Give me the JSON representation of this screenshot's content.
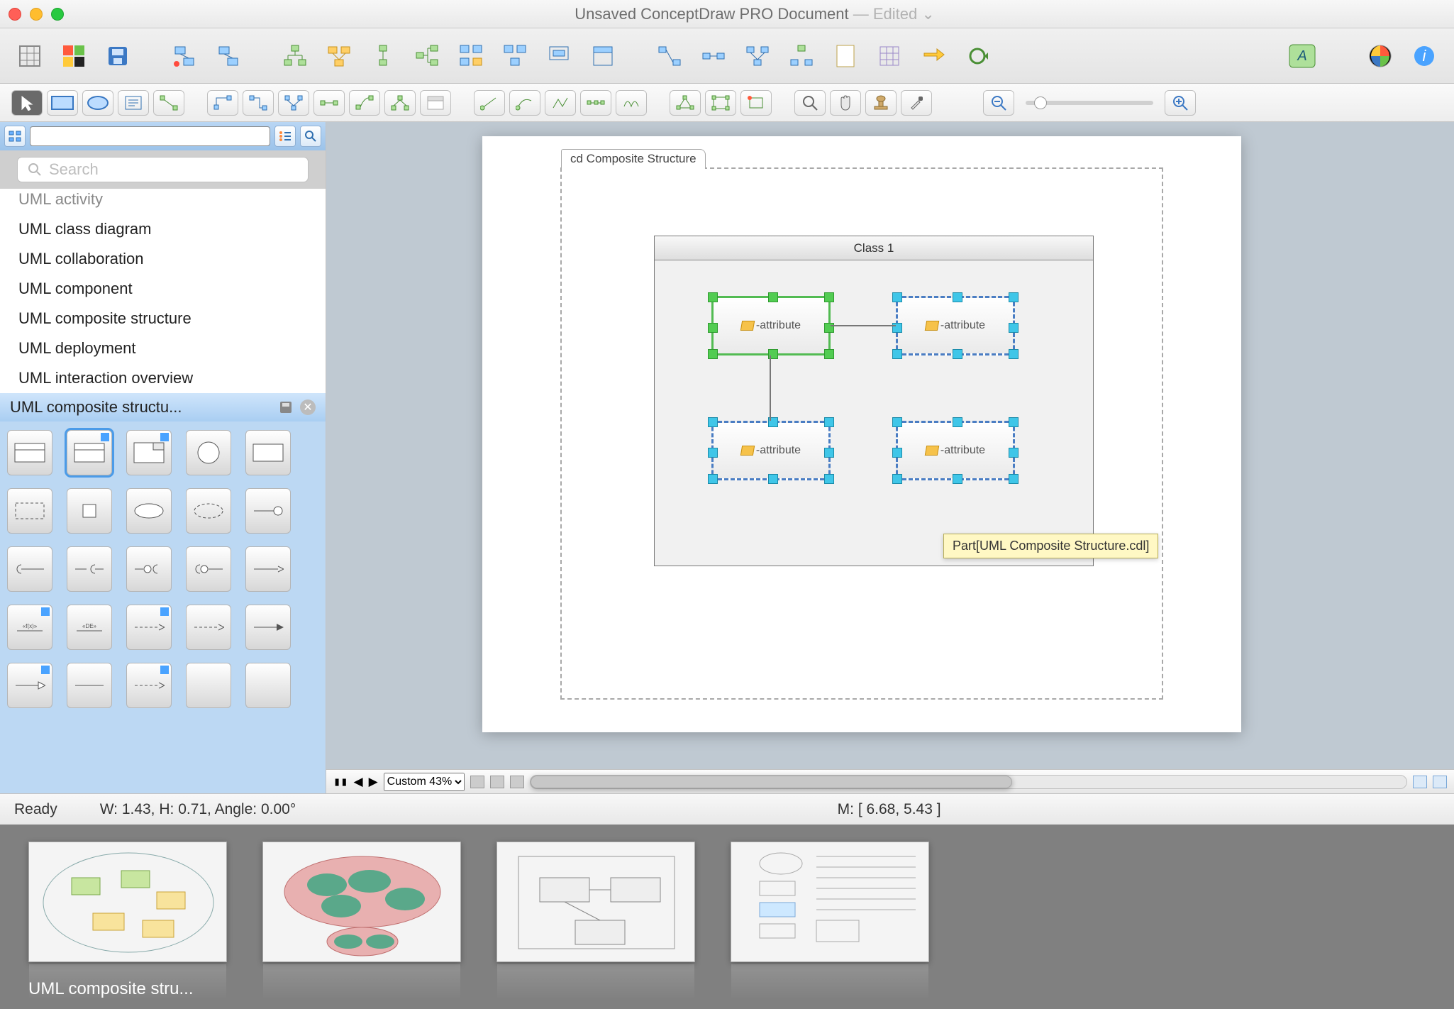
{
  "window": {
    "title_main": "Unsaved ConceptDraw PRO Document",
    "title_suffix": " — Edited ⌄"
  },
  "sidebar": {
    "search_placeholder": "Search",
    "categories_cut": "UML activity",
    "categories": [
      "UML class diagram",
      "UML collaboration",
      "UML component",
      "UML composite structure",
      "UML deployment",
      "UML interaction overview"
    ],
    "library_title": "UML composite structu..."
  },
  "canvas": {
    "frame_label": "cd Composite Structure",
    "class_title": "Class 1",
    "part_label": "-attribute",
    "tooltip": "Part[UML Composite Structure.cdl]"
  },
  "nav": {
    "zoom_label": "Custom 43%"
  },
  "status": {
    "ready": "Ready",
    "dims": "W: 1.43,  H: 0.71,  Angle: 0.00°",
    "mouse": "M: [ 6.68, 5.43 ]"
  },
  "tray": {
    "caption": "UML composite stru..."
  }
}
